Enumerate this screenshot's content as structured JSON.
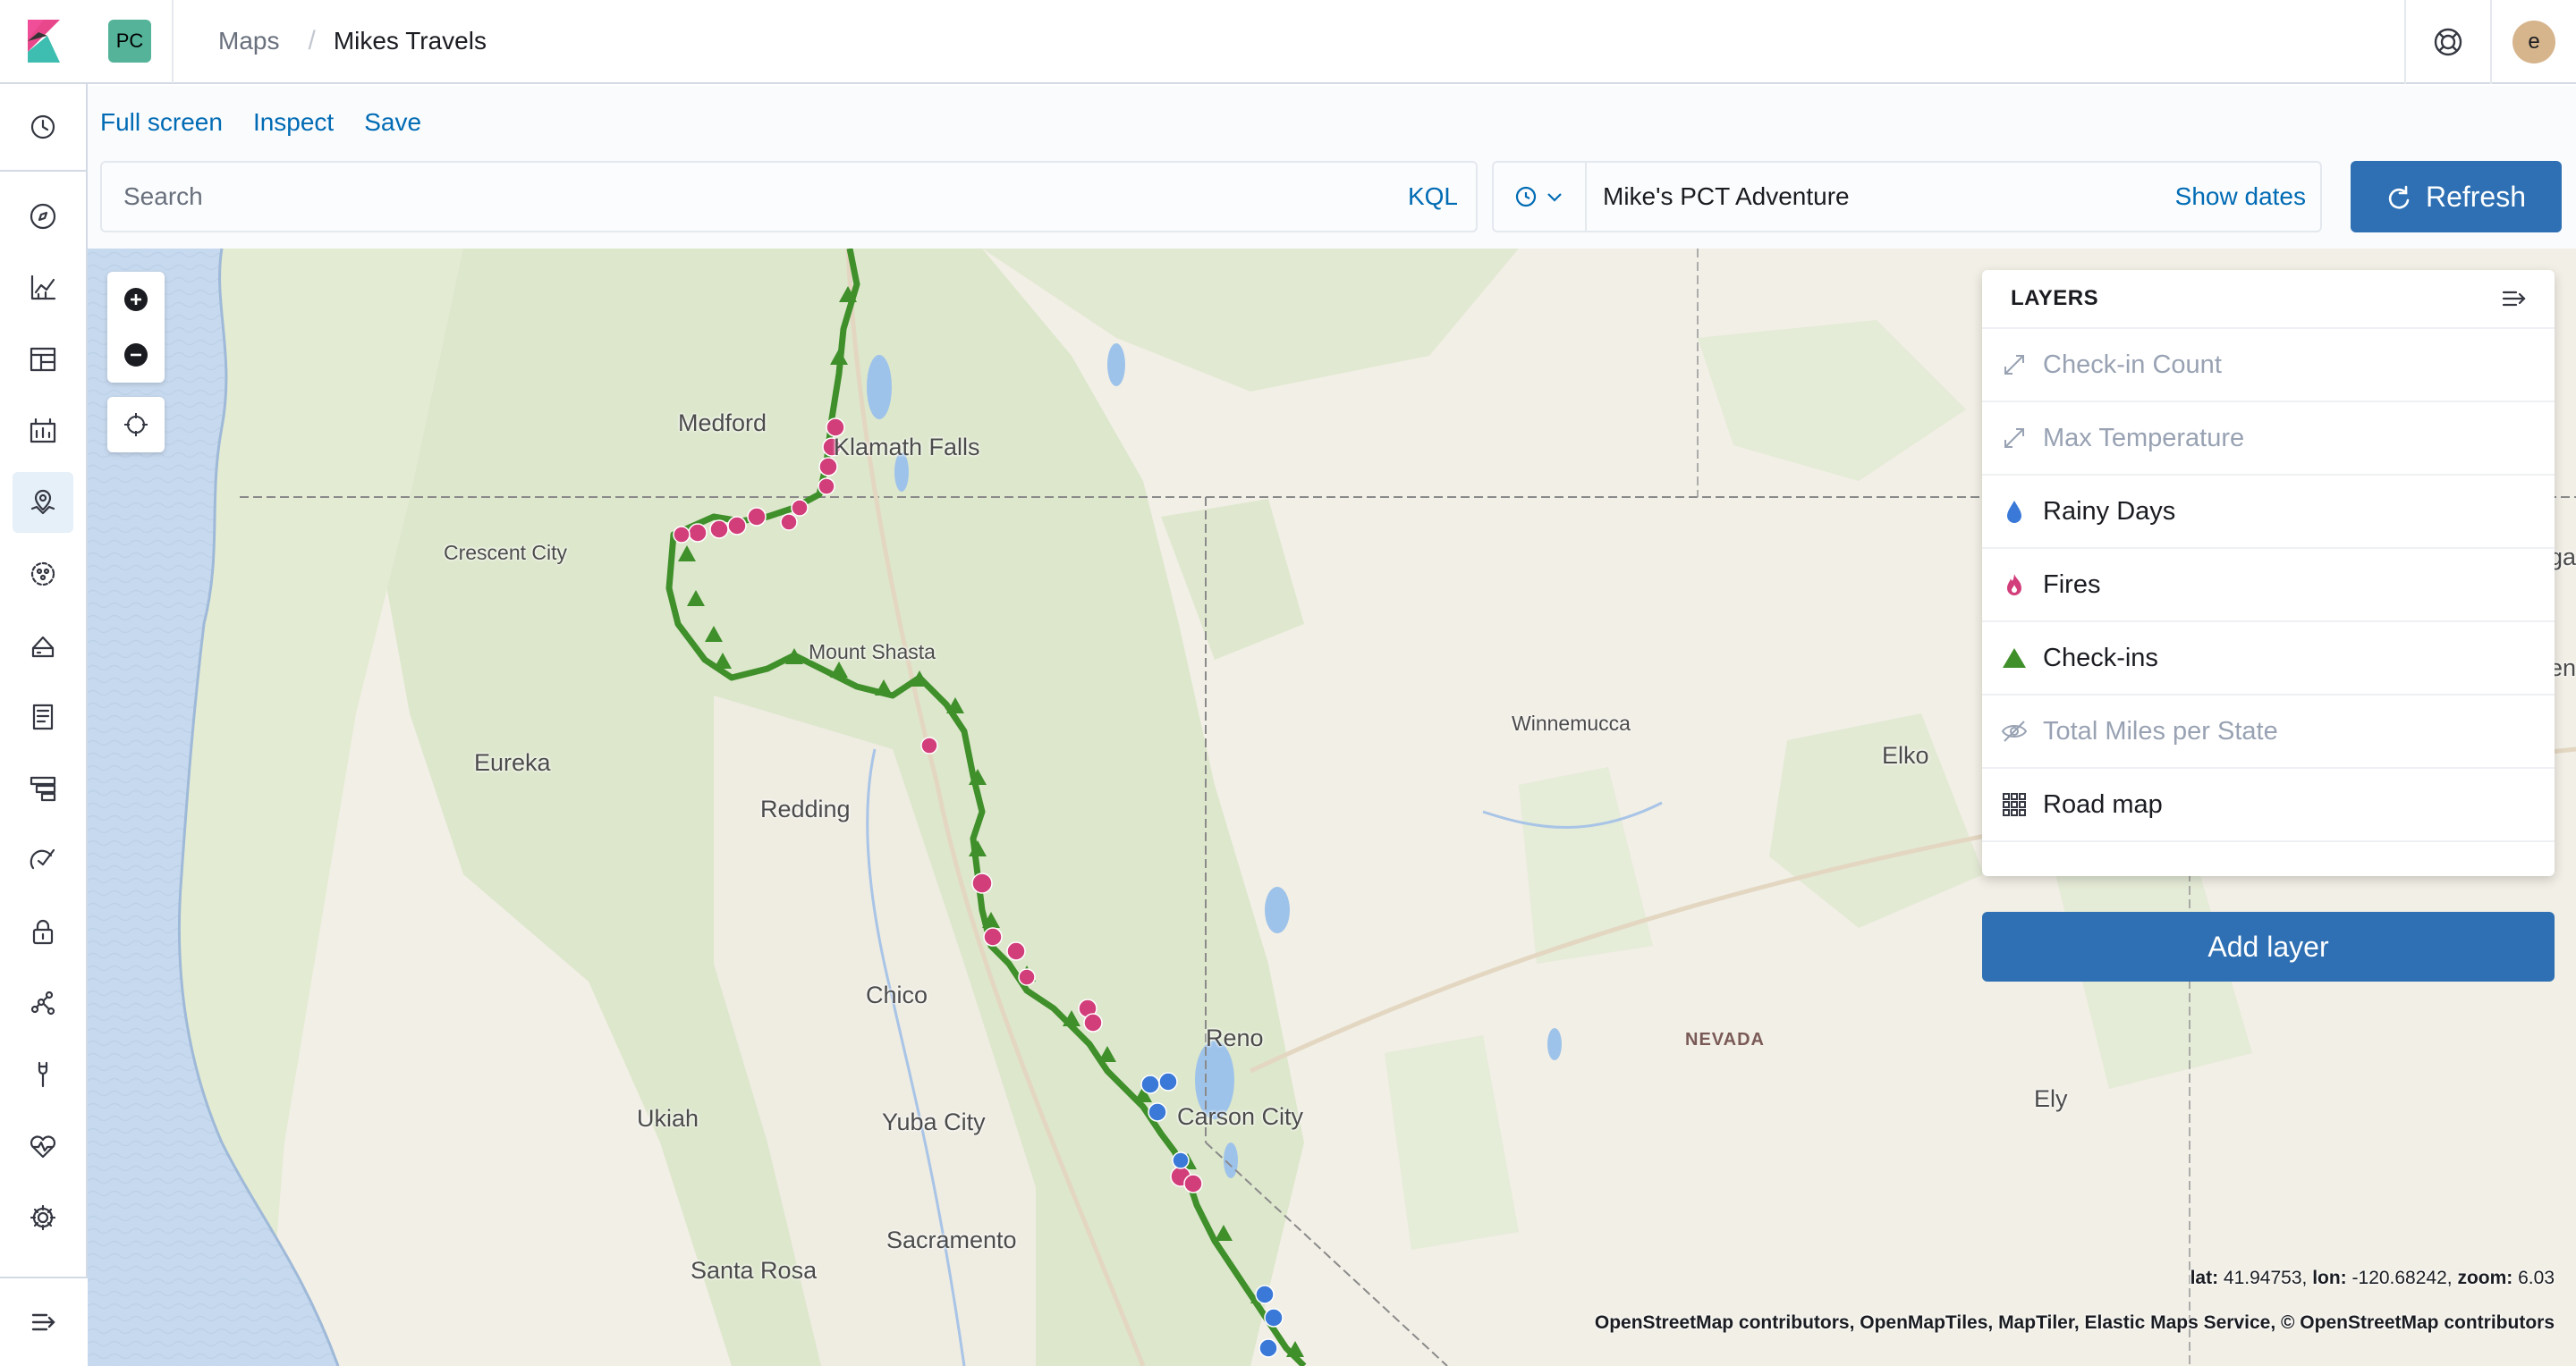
{
  "header": {
    "space_initials": "PC",
    "breadcrumbs": [
      "Maps",
      "Mikes Travels"
    ],
    "avatar_initial": "e"
  },
  "topnav": {
    "full_screen": "Full screen",
    "inspect": "Inspect",
    "save": "Save"
  },
  "query": {
    "search_placeholder": "Search",
    "language": "KQL",
    "time_label": "Mike's PCT Adventure",
    "show_dates": "Show dates",
    "refresh": "Refresh"
  },
  "map": {
    "cities": [
      {
        "name": "Medford"
      },
      {
        "name": "Klamath Falls"
      },
      {
        "name": "Crescent City"
      },
      {
        "name": "Mount Shasta"
      },
      {
        "name": "Eureka"
      },
      {
        "name": "Redding"
      },
      {
        "name": "Winnemucca"
      },
      {
        "name": "Elko"
      },
      {
        "name": "Chico"
      },
      {
        "name": "Reno"
      },
      {
        "name": "Carson City"
      },
      {
        "name": "Ukiah"
      },
      {
        "name": "Yuba City"
      },
      {
        "name": "Sacramento"
      },
      {
        "name": "Santa Rosa"
      },
      {
        "name": "Ely"
      }
    ],
    "state_label": "NEVADA",
    "edge_labels": [
      "ga",
      "en"
    ],
    "coordinates": {
      "lat": "41.94753",
      "lon": "-120.68242",
      "zoom": "6.03"
    },
    "coord_labels": {
      "lat": "lat:",
      "lon": "lon:",
      "zoom": "zoom:"
    },
    "attribution": "OpenStreetMap contributors, OpenMapTiles, MapTiler, Elastic Maps Service, © OpenStreetMap contributors"
  },
  "layers": {
    "title": "LAYERS",
    "items": [
      {
        "name": "Check-in Count",
        "icon": "resize-arrow-icon",
        "visible": false
      },
      {
        "name": "Max Temperature",
        "icon": "resize-arrow-icon",
        "visible": false
      },
      {
        "name": "Rainy Days",
        "icon": "drop-icon",
        "color": "#3a79d8",
        "visible": true
      },
      {
        "name": "Fires",
        "icon": "fire-icon",
        "color": "#d23e7a",
        "visible": true
      },
      {
        "name": "Check-ins",
        "icon": "triangle-icon",
        "color": "#3f8f2a",
        "visible": true
      },
      {
        "name": "Total Miles per State",
        "icon": "eye-closed-icon",
        "visible": false
      },
      {
        "name": "Road map",
        "icon": "grid-icon",
        "visible": true
      }
    ],
    "add_layer": "Add layer"
  },
  "colors": {
    "accent": "#006bb4",
    "primary_button": "#2e70b3",
    "checkins": "#3f8f2a",
    "fires": "#d23e7a",
    "rain": "#3a79d8"
  }
}
